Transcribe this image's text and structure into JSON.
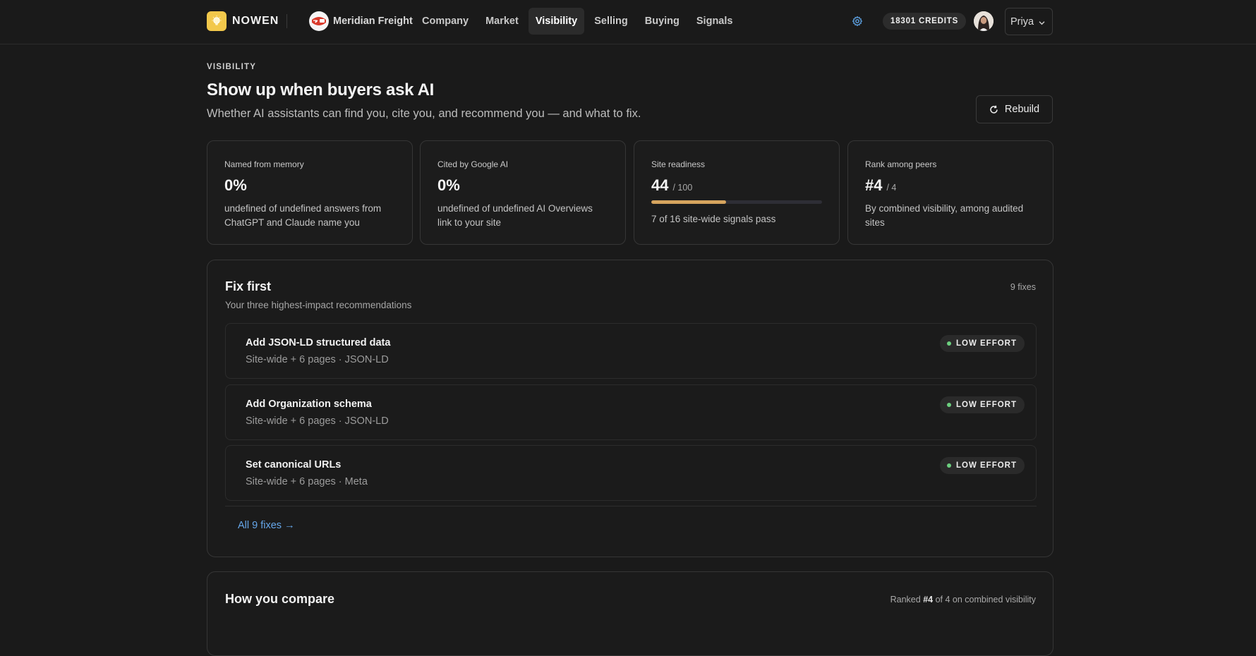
{
  "brand": {
    "name": "NOWEN",
    "logo_icon": "lightbulb-icon",
    "logo_color": "#f2c84b"
  },
  "company": {
    "name": "Meridian Freight"
  },
  "nav": {
    "items": [
      {
        "label": "Company"
      },
      {
        "label": "Market"
      },
      {
        "label": "Visibility",
        "active": true
      },
      {
        "label": "Selling"
      },
      {
        "label": "Buying"
      },
      {
        "label": "Signals"
      }
    ]
  },
  "header_right": {
    "settings_icon": "gear-icon",
    "credits": "18301 CREDITS",
    "user": {
      "name": "Priya"
    }
  },
  "page": {
    "eyebrow": "VISIBILITY",
    "title": "Show up when buyers ask AI",
    "subtitle": "Whether AI assistants can find you, cite you, and recommend you — and what to fix.",
    "rebuild_label": "Rebuild"
  },
  "stats": [
    {
      "label": "Named from memory",
      "value": "0%",
      "desc": "undefined of undefined answers from ChatGPT and Claude name you"
    },
    {
      "label": "Cited by Google AI",
      "value": "0%",
      "desc": "undefined of undefined AI Overviews link to your site"
    },
    {
      "label": "Site readiness",
      "value": "44",
      "sub": "/ 100",
      "progress": 0.44,
      "desc": "7 of 16 site-wide signals pass"
    },
    {
      "label": "Rank among peers",
      "value": "#4",
      "sub": "/ 4",
      "desc": "By combined visibility, among audited sites"
    }
  ],
  "fix_first": {
    "title": "Fix first",
    "subtitle": "Your three highest-impact recommendations",
    "count": "9 fixes",
    "items": [
      {
        "title": "Add JSON-LD structured data",
        "meta": "Site-wide + 6 pages · JSON-LD",
        "effort": "LOW EFFORT"
      },
      {
        "title": "Add Organization schema",
        "meta": "Site-wide + 6 pages · JSON-LD",
        "effort": "LOW EFFORT"
      },
      {
        "title": "Set canonical URLs",
        "meta": "Site-wide + 6 pages · Meta",
        "effort": "LOW EFFORT"
      }
    ],
    "all_link": "All 9 fixes →"
  },
  "compare": {
    "title": "How you compare",
    "meta_prefix": "Ranked ",
    "meta_rank": "#4",
    "meta_suffix": " of 4 on combined visibility"
  },
  "colors": {
    "background": "#1a1a1a",
    "accent_link": "#66a7ea",
    "progress_fill": "#d6a45e",
    "effort_dot": "#6ccf7f"
  }
}
